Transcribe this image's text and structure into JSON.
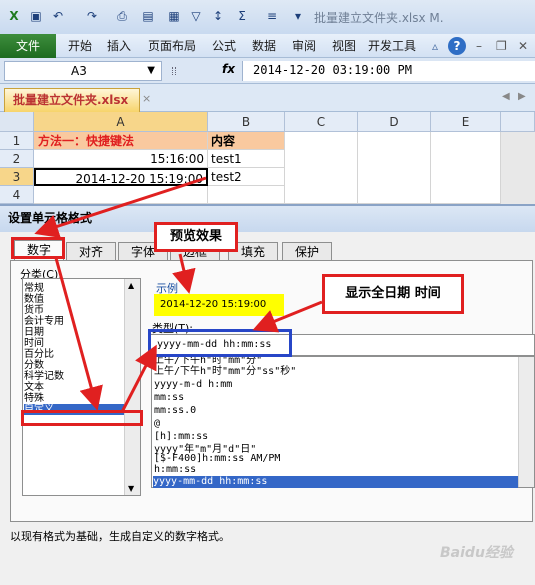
{
  "window": {
    "title": "批量建立文件夹.xlsx M."
  },
  "qat": {
    "icons": [
      "save-icon",
      "undo-icon",
      "redo-icon",
      "print-preview-icon",
      "format-icon",
      "number-icon",
      "filter-icon",
      "sort-icon",
      "sum-icon",
      "align-icon",
      "more-icon"
    ]
  },
  "ribbon": {
    "file": "文件",
    "tabs": [
      "开始",
      "插入",
      "页面布局",
      "公式",
      "数据",
      "审阅",
      "视图",
      "开发工具"
    ]
  },
  "formula": {
    "namebox": "A3",
    "fx": "fx",
    "value": "2014-12-20  03:19:00 PM"
  },
  "workbook": {
    "tab": "批量建立文件夹.xlsx"
  },
  "sheet": {
    "columns": [
      "A",
      "B",
      "C",
      "D",
      "E"
    ],
    "rows": [
      "1",
      "2",
      "3",
      "4"
    ],
    "cells": {
      "a1": "方法一：快捷键法",
      "b1": "内容",
      "a2": "15:16:00",
      "b2": "test1",
      "a3": "2014-12-20 15:19:00",
      "b3": "test2"
    }
  },
  "dialog": {
    "title": "设置单元格格式",
    "tabs": [
      "数字",
      "对齐",
      "字体",
      "边框",
      "填充",
      "保护"
    ],
    "category_label": "分类(C):",
    "categories": [
      "常规",
      "数值",
      "货币",
      "会计专用",
      "日期",
      "时间",
      "百分比",
      "分数",
      "科学记数",
      "文本",
      "特殊",
      "自定义"
    ],
    "selected_category": "自定义",
    "sample_label": "示例",
    "sample_value": "2014-12-20 15:19:00",
    "type_label": "类型(T):",
    "type_value": "yyyy-mm-dd hh:mm:ss",
    "formats": [
      "上午/下午h\"时\"mm\"分\"",
      "上午/下午h\"时\"mm\"分\"ss\"秒\"",
      "yyyy-m-d h:mm",
      "mm:ss",
      "mm:ss.0",
      "@",
      "[h]:mm:ss",
      "yyyy\"年\"m\"月\"d\"日\"",
      "[$-F400]h:mm:ss AM/PM",
      "h:mm:ss",
      "yyyy-mm-dd hh:mm:ss"
    ],
    "selected_format": "yyyy-mm-dd hh:mm:ss",
    "description": "以现有格式为基础，生成自定义的数字格式。"
  },
  "annotations": {
    "preview": "预览效果",
    "show_full": "显示全日期  时间"
  },
  "colors": {
    "annotation": "#e02020",
    "highlight": "#ffff00",
    "selection": "#3467c7",
    "file_tab": "#1d6b1f",
    "header_a1": "#f9c99f"
  }
}
